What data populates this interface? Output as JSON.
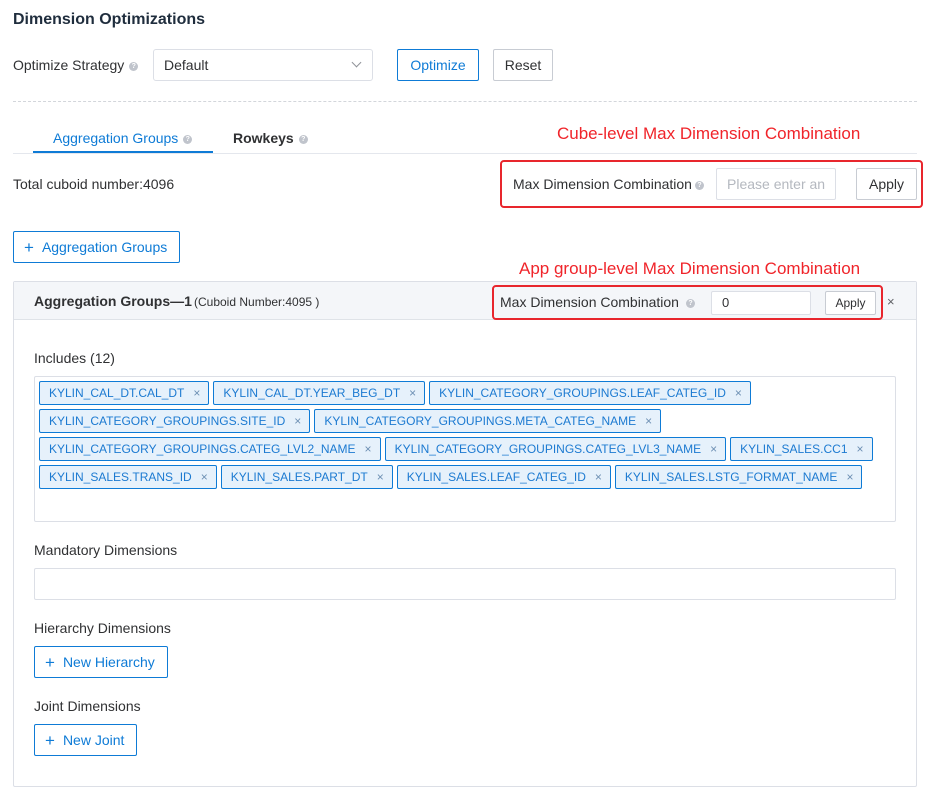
{
  "page_title": "Dimension Optimizations",
  "strategy": {
    "label": "Optimize Strategy",
    "selected": "Default",
    "help_icon": "question-circle-icon"
  },
  "buttons": {
    "optimize": "Optimize",
    "reset": "Reset"
  },
  "tabs": [
    {
      "label": "Aggregation Groups",
      "active": true
    },
    {
      "label": "Rowkeys",
      "active": false
    }
  ],
  "annotations": {
    "cube_level": "Cube-level Max Dimension Combination",
    "group_level": "App group-level Max Dimension Combination"
  },
  "total_cuboid": "Total cuboid number:4096",
  "cube_max_dim": {
    "label": "Max Dimension Combination",
    "placeholder": "Please enter an",
    "apply": "Apply"
  },
  "add_group_button": "Aggregation Groups",
  "group": {
    "title": "Aggregation Groups—1",
    "cuboid_number": "(Cuboid Number:4095 )",
    "max_dim_label": "Max Dimension Combination",
    "max_dim_value": "0",
    "apply": "Apply",
    "includes_label": "Includes (12)",
    "includes": [
      "KYLIN_CAL_DT.CAL_DT",
      "KYLIN_CAL_DT.YEAR_BEG_DT",
      "KYLIN_CATEGORY_GROUPINGS.LEAF_CATEG_ID",
      "KYLIN_CATEGORY_GROUPINGS.SITE_ID",
      "KYLIN_CATEGORY_GROUPINGS.META_CATEG_NAME",
      "KYLIN_CATEGORY_GROUPINGS.CATEG_LVL2_NAME",
      "KYLIN_CATEGORY_GROUPINGS.CATEG_LVL3_NAME",
      "KYLIN_SALES.CC1",
      "KYLIN_SALES.TRANS_ID",
      "KYLIN_SALES.PART_DT",
      "KYLIN_SALES.LEAF_CATEG_ID",
      "KYLIN_SALES.LSTG_FORMAT_NAME"
    ],
    "mandatory_label": "Mandatory Dimensions",
    "hierarchy_label": "Hierarchy Dimensions",
    "new_hierarchy": "New Hierarchy",
    "joint_label": "Joint Dimensions",
    "new_joint": "New Joint"
  },
  "colors": {
    "accent": "#0e7bd6",
    "annotation": "#f0242a",
    "tag_bg": "#e6f1fb"
  }
}
